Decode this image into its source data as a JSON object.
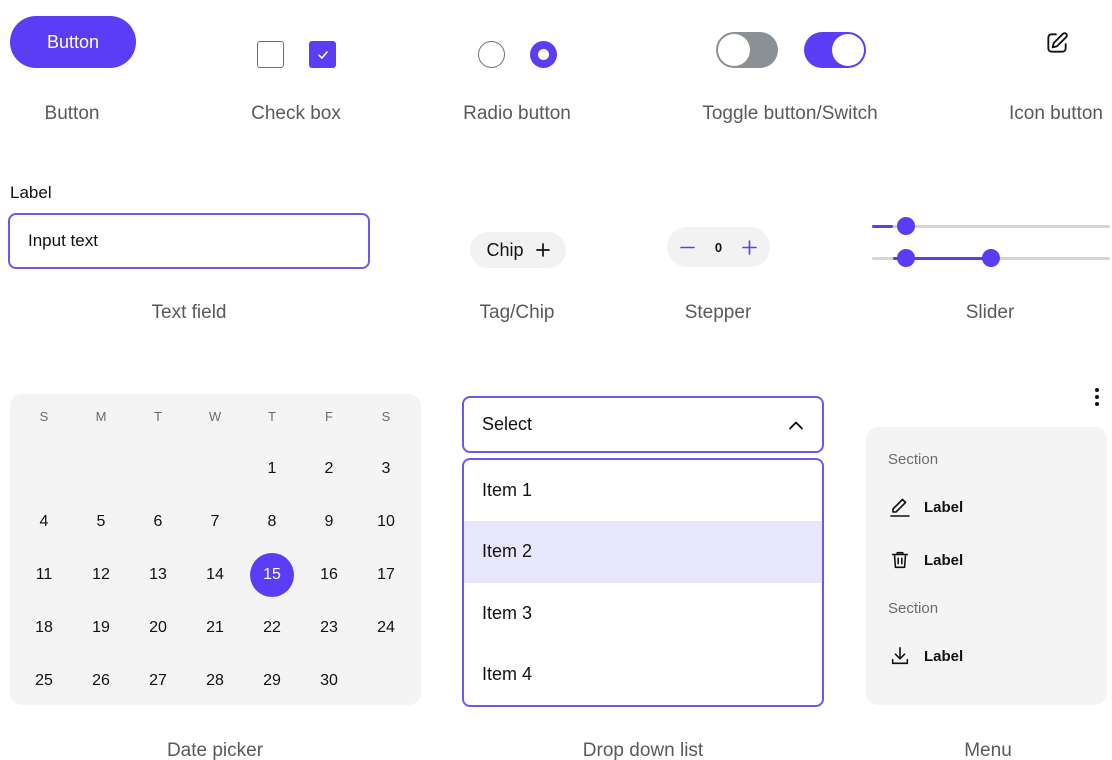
{
  "colors": {
    "accent": "#5b3df5",
    "accent_border": "#6e57f0",
    "surface": "#f5f4f5",
    "highlight": "#e8e6fd",
    "toggle_off": "#8b9095"
  },
  "button": {
    "label": "Button",
    "caption": "Button"
  },
  "checkbox": {
    "caption": "Check box",
    "states": [
      false,
      true
    ]
  },
  "radio": {
    "caption": "Radio button",
    "states": [
      false,
      true
    ]
  },
  "toggle": {
    "caption": "Toggle button/Switch",
    "states": [
      false,
      true
    ]
  },
  "icon_button": {
    "icon": "edit-icon",
    "caption": "Icon button"
  },
  "text_field": {
    "label": "Label",
    "value": "Input text",
    "caption": "Text field"
  },
  "chip": {
    "label": "Chip",
    "icon": "plus-icon",
    "caption": "Tag/Chip"
  },
  "stepper": {
    "value": "0",
    "caption": "Stepper"
  },
  "slider": {
    "caption": "Slider",
    "single_value": 0.09,
    "range_values": [
      0.09,
      0.5
    ]
  },
  "date_picker": {
    "caption": "Date picker",
    "weekdays": [
      "S",
      "M",
      "T",
      "W",
      "T",
      "F",
      "S"
    ],
    "first_weekday_index": 4,
    "days_in_month": 30,
    "selected_day": 15
  },
  "dropdown": {
    "caption": "Drop down list",
    "placeholder": "Select",
    "items": [
      "Item 1",
      "Item 2",
      "Item 3",
      "Item 4"
    ],
    "highlighted_index": 1
  },
  "menu": {
    "caption": "Menu",
    "sections": [
      {
        "title": "Section",
        "items": [
          {
            "icon": "pencil-icon",
            "label": "Label"
          },
          {
            "icon": "trash-icon",
            "label": "Label"
          }
        ]
      },
      {
        "title": "Section",
        "items": [
          {
            "icon": "download-icon",
            "label": "Label"
          }
        ]
      }
    ]
  }
}
